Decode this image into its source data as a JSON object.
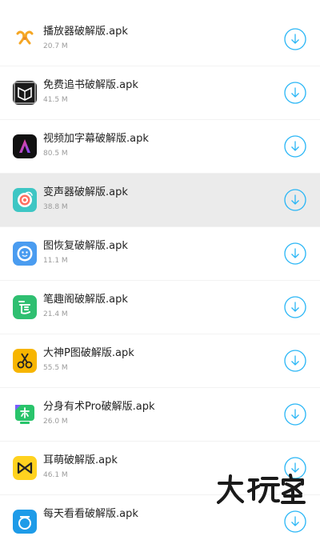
{
  "files": [
    {
      "name": "播放器破解版.apk",
      "size": "20.7 M",
      "icon": "player-app-icon"
    },
    {
      "name": "免费追书破解版.apk",
      "size": "41.5 M",
      "icon": "free-reader-app-icon"
    },
    {
      "name": "视频加字幕破解版.apk",
      "size": "80.5 M",
      "icon": "video-subtitle-app-icon"
    },
    {
      "name": "变声器破解版.apk",
      "size": "38.8 M",
      "icon": "voice-changer-app-icon"
    },
    {
      "name": "图恢复破解版.apk",
      "size": "11.1 M",
      "icon": "photo-recovery-app-icon"
    },
    {
      "name": "笔趣阁破解版.apk",
      "size": "21.4 M",
      "icon": "biquge-app-icon"
    },
    {
      "name": "大神P图破解版.apk",
      "size": "55.5 M",
      "icon": "photo-editor-app-icon"
    },
    {
      "name": "分身有术Pro破解版.apk",
      "size": "26.0 M",
      "icon": "app-clone-app-icon"
    },
    {
      "name": "耳萌破解版.apk",
      "size": "46.1 M",
      "icon": "ermeng-app-icon"
    },
    {
      "name": "每天看看破解版.apk",
      "size": "",
      "icon": "daily-look-app-icon"
    }
  ],
  "selected_index": 3,
  "colors": {
    "accent": "#29b6f6",
    "selected_row_bg": "#ebebeb",
    "title_text": "#222222",
    "size_text": "#9a9a9a"
  },
  "watermark": {
    "text": "大玩家",
    "kind": "logo"
  }
}
